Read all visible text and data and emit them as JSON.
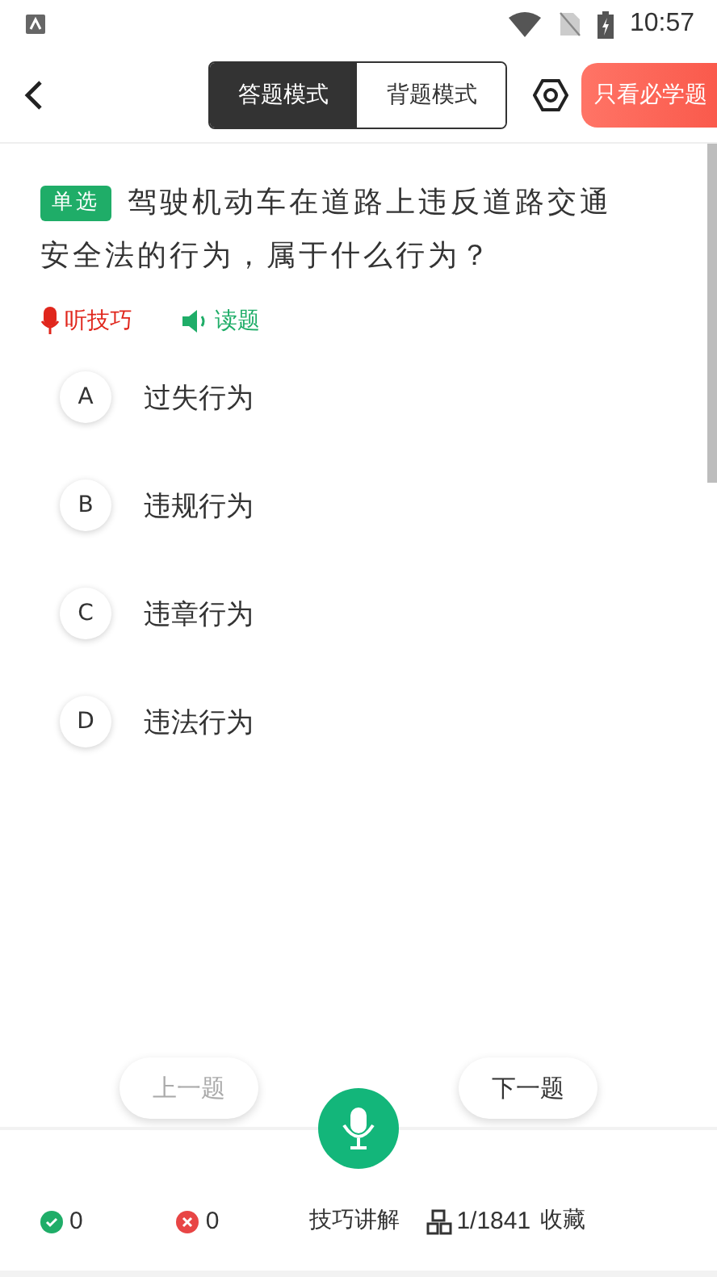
{
  "status_bar": {
    "time": "10:57"
  },
  "header": {
    "tabs": [
      {
        "label": "答题模式",
        "selected": true
      },
      {
        "label": "背题模式",
        "selected": false
      }
    ],
    "filter_button": "只看必学题"
  },
  "question": {
    "type_badge": "单选",
    "text": "驾驶机动车在道路上违反道路交通安全法的行为，属于什么行为？"
  },
  "audio_actions": [
    {
      "kind": "tips",
      "label": "听技巧"
    },
    {
      "kind": "read",
      "label": "读题"
    }
  ],
  "options": [
    {
      "letter": "A",
      "text": "过失行为",
      "selected": false
    },
    {
      "letter": "B",
      "text": "违规行为",
      "selected": false
    },
    {
      "letter": "C",
      "text": "违章行为",
      "selected": false
    },
    {
      "letter": "D",
      "text": "违法行为",
      "selected": false
    }
  ],
  "nav": [
    {
      "label": "上一题",
      "disabled": true
    },
    {
      "label": "下一题",
      "disabled": false
    }
  ],
  "bottom_bar": {
    "correct": "0",
    "wrong": "0",
    "explain": "技巧讲解",
    "progress": "1/1841",
    "favorite": "收藏"
  }
}
